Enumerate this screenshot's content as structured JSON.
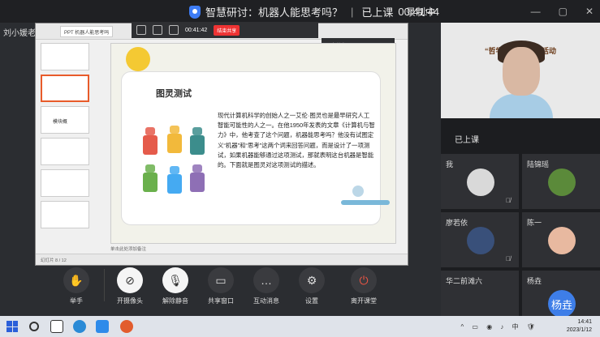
{
  "window": {
    "title": "智慧研讨：机器人能思考吗？",
    "status": "已上课",
    "timer": "00:41:44",
    "recording": "录制中"
  },
  "presenter": "刘小媛老",
  "ppt": {
    "tabs": [
      "PPT 机器人能思考吗"
    ],
    "toolbar_time": "00:41:42",
    "toolbar_end": "结束共享",
    "popup": "正在共享",
    "thumb_label": "模块概",
    "notes_placeholder": "单击此处添加备注",
    "status": "幻灯片 8 / 12"
  },
  "slide": {
    "title": "图灵测试",
    "body": "现代计算机科学的创始人之一艾伦·图灵也是最早研究人工智能可能性的人之一。在他1950年发表的文章《计算机与智力》中，他考查了这个问题，机器能思考吗？他没有试图定义“机器”和“思考”这两个词来回答问题，而是设计了一项测试，如果机器能够通过这项测试，那就表明这台机器是智能的。下面就是图灵对这项测试的描述。"
  },
  "right": {
    "banner": "“哲学生活   上主题活动",
    "status_text": "已上课",
    "participants": [
      {
        "name": "我"
      },
      {
        "name": "陆锦瑶"
      },
      {
        "name": "廖若依"
      },
      {
        "name": "陈一"
      },
      {
        "name": "华二前滩六"
      },
      {
        "name": "杨垚",
        "avatar_text": "杨垚"
      }
    ]
  },
  "controls": [
    {
      "label": "举手",
      "icon": "hand-icon"
    },
    {
      "label": "开摄像头",
      "icon": "camera-off-icon"
    },
    {
      "label": "解除静音",
      "icon": "mic-off-icon"
    },
    {
      "label": "共享窗口",
      "icon": "screen-share-icon"
    },
    {
      "label": "互动消息",
      "icon": "chat-icon"
    },
    {
      "label": "设置",
      "icon": "gear-icon"
    },
    {
      "label": "离开课堂",
      "icon": "power-icon"
    }
  ],
  "taskbar": {
    "time": "14:41",
    "date": "2023/1/12"
  }
}
